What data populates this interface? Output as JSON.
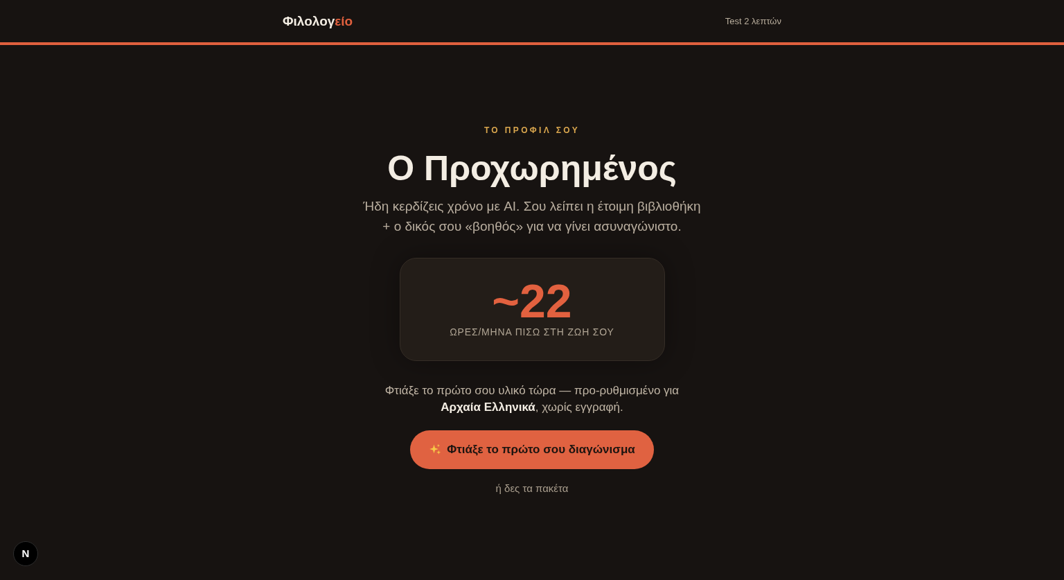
{
  "header": {
    "logo": {
      "text": "Φιλολογ",
      "accent": "είο"
    },
    "nav_link": "Test 2 λεπτών"
  },
  "profile": {
    "eyebrow": "ΤΟ ΠΡΟΦΙΛ ΣΟΥ",
    "title": "Ο Προχωρημένος",
    "description": "Ήδη κερδίζεις χρόνο με AI. Σου λείπει η έτοιμη βιβλιοθήκη + ο δικός σου «βοηθός» για να γίνει ασυναγώνιστο."
  },
  "stat_card": {
    "value": "~22",
    "label": "ΩΡΕΣ/ΜΗΝΑ ΠΙΣΩ ΣΤΗ ΖΩΗ ΣΟΥ"
  },
  "cta": {
    "note": "Φτιάξε το πρώτο σου υλικό τώρα — προ-ρυθμισμένο για **Αρχαία Ελληνικά**, χωρίς εγγραφή.",
    "button": "Φτιάξε το πρώτο σου διαγώνισμα",
    "secondary_link": "ή δες τα πακέτα"
  },
  "dev_badge": {
    "label": "N"
  }
}
